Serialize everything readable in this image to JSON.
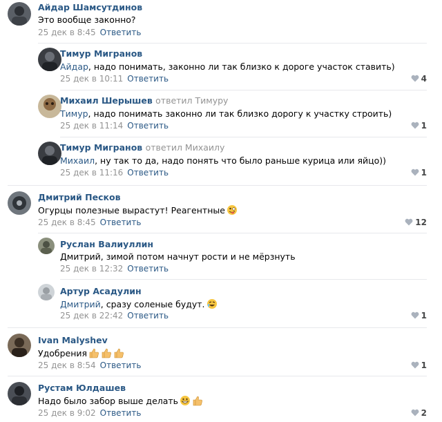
{
  "comments": [
    {
      "name": "Айдар Шамсутдинов",
      "text": "Это вообще законно?",
      "date": "25 дек в 8:45",
      "reply": "Ответить",
      "likes": ""
    },
    {
      "name": "Тимур Мигранов",
      "replied": "",
      "mention": "Айдар",
      "text": ", надо понимать, законно ли так близко к дороге участок ставить)",
      "date": "25 дек в 10:11",
      "reply": "Ответить",
      "likes": "4"
    },
    {
      "name": "Михаил Шерышев",
      "replied": "ответил Тимуру",
      "mention": "Тимур",
      "text": ", надо понимать законно ли так близко дорогу к участку строить)",
      "date": "25 дек в 11:14",
      "reply": "Ответить",
      "likes": "1"
    },
    {
      "name": "Тимур Мигранов",
      "replied": "ответил Михаилу",
      "mention": "Михаил",
      "text": ", ну так то да, надо понять что было раньше курица или яйцо))",
      "date": "25 дек в 11:16",
      "reply": "Ответить",
      "likes": "1"
    },
    {
      "name": "Дмитрий Песков",
      "text": "Огурцы полезные вырастут! Реагентные",
      "date": "25 дек в 8:45",
      "reply": "Ответить",
      "likes": "12"
    },
    {
      "name": "Руслан Валиуллин",
      "text": "Дмитрий, зимой потом начнут рости и не мёрзнуть",
      "date": "25 дек в 12:32",
      "reply": "Ответить",
      "likes": ""
    },
    {
      "name": "Артур Асадулин",
      "mention": "Дмитрий",
      "text": ", сразу соленые будут.",
      "date": "25 дек в 22:42",
      "reply": "Ответить",
      "likes": "1"
    },
    {
      "name": "Ivan Malyshev",
      "text": "Удобрения",
      "date": "25 дек в 8:54",
      "reply": "Ответить",
      "likes": "1"
    },
    {
      "name": "Рустам Юлдашев",
      "text": "Надо было забор выше делать",
      "date": "25 дек в 9:02",
      "reply": "Ответить",
      "likes": "2"
    }
  ],
  "colors": {
    "link": "#2a5885",
    "meta": "#939393",
    "separator": "#e7e8ec"
  },
  "icons": {
    "like": "heart-icon",
    "emoji_tongue": "crazy-face-emoji",
    "emoji_laugh": "rofl-emoji",
    "emoji_thumb": "thumbs-up-emoji",
    "emoji_grin": "grin-emoji"
  }
}
